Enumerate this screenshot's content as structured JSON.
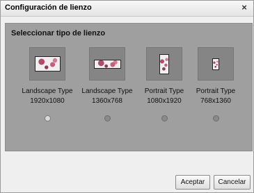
{
  "dialog": {
    "title": "Configuración de lienzo",
    "close_glyph": "×"
  },
  "section": {
    "title": "Seleccionar tipo de lienzo"
  },
  "options": [
    {
      "name": "Landscape Type",
      "resolution": "1920x1080",
      "selected": true
    },
    {
      "name": "Landscape Type",
      "resolution": "1360x768",
      "selected": false
    },
    {
      "name": "Portrait Type",
      "resolution": "1080x1920",
      "selected": false
    },
    {
      "name": "Portrait Type",
      "resolution": "768x1360",
      "selected": false
    }
  ],
  "buttons": {
    "accept": "Aceptar",
    "cancel": "Cancelar"
  }
}
